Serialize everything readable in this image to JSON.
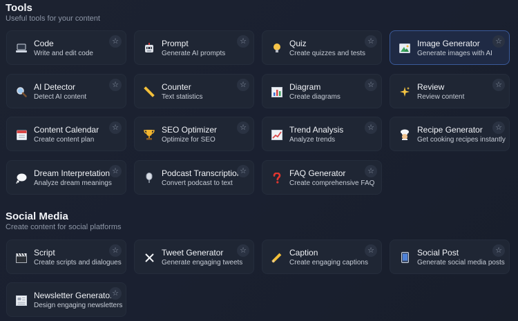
{
  "tools": {
    "title": "Tools",
    "subtitle": "Useful tools for your content",
    "items": [
      {
        "name": "Code",
        "desc": "Write and edit code",
        "icon": "laptop-icon"
      },
      {
        "name": "Prompt",
        "desc": "Generate AI prompts",
        "icon": "robot-icon"
      },
      {
        "name": "Quiz",
        "desc": "Create quizzes and tests",
        "icon": "lightbulb-icon"
      },
      {
        "name": "Image Generator",
        "desc": "Generate images with AI",
        "icon": "image-icon"
      },
      {
        "name": "AI Detector",
        "desc": "Detect AI content",
        "icon": "magnifier-icon"
      },
      {
        "name": "Counter",
        "desc": "Text statistics",
        "icon": "ruler-icon"
      },
      {
        "name": "Diagram",
        "desc": "Create diagrams",
        "icon": "bar-chart-icon"
      },
      {
        "name": "Review",
        "desc": "Review content",
        "icon": "sparkles-icon"
      },
      {
        "name": "Content Calendar",
        "desc": "Create content plan",
        "icon": "calendar-icon"
      },
      {
        "name": "SEO Optimizer",
        "desc": "Optimize for SEO",
        "icon": "trophy-icon"
      },
      {
        "name": "Trend Analysis",
        "desc": "Analyze trends",
        "icon": "trend-chart-icon"
      },
      {
        "name": "Recipe Generator",
        "desc": "Get cooking recipes instantly",
        "icon": "chef-icon"
      },
      {
        "name": "Dream Interpretation",
        "desc": "Analyze dream meanings",
        "icon": "thought-bubble-icon"
      },
      {
        "name": "Podcast Transcription",
        "desc": "Convert podcast to text",
        "icon": "microphone-icon"
      },
      {
        "name": "FAQ Generator",
        "desc": "Create comprehensive FAQ",
        "icon": "question-mark-icon"
      }
    ]
  },
  "social": {
    "title": "Social Media",
    "subtitle": "Create content for social platforms",
    "items": [
      {
        "name": "Script",
        "desc": "Create scripts and dialogues",
        "icon": "clapperboard-icon"
      },
      {
        "name": "Tweet Generator",
        "desc": "Generate engaging tweets",
        "icon": "x-logo-icon"
      },
      {
        "name": "Caption",
        "desc": "Create engaging captions",
        "icon": "pencil-icon"
      },
      {
        "name": "Social Post",
        "desc": "Generate social media posts",
        "icon": "phone-icon"
      },
      {
        "name": "Newsletter Generator",
        "desc": "Design engaging newsletters",
        "icon": "newspaper-icon"
      }
    ]
  },
  "star_glyph": "☆",
  "selected_tool": "Image Generator",
  "colors": {
    "background": "#1c2230",
    "card": "#1f2634",
    "selected_border": "#3a5a9a"
  }
}
